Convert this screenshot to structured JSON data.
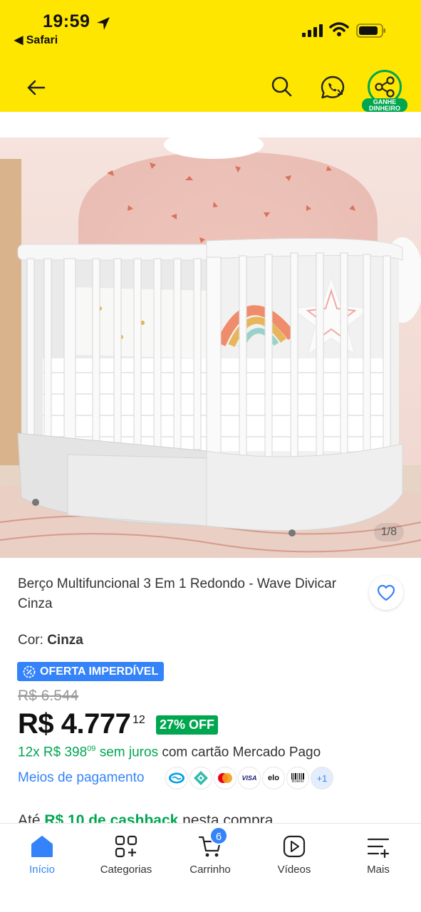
{
  "status_bar": {
    "time": "19:59",
    "back_app": "◀ Safari"
  },
  "header": {
    "share_badge_line1": "GANHE",
    "share_badge_line2": "DINHEIRO"
  },
  "gallery": {
    "counter": "1/8"
  },
  "product": {
    "title": "Berço Multifuncional 3 Em 1 Redondo - Wave Divicar Cinza",
    "color_label": "Cor: ",
    "color_value": "Cinza",
    "offer_badge": "OFERTA IMPERDÍVEL",
    "old_price": "R$ 6.544",
    "price": "R$ 4.777",
    "price_cents": "12",
    "discount": "27% OFF",
    "installments_prefix": "12x R$ 398",
    "installments_cents": "09",
    "installments_interest": " sem juros",
    "installments_suffix": " com cartão Mercado Pago",
    "payment_methods_link": "Meios de pagamento",
    "payment_icons": [
      "mercado-pago-icon",
      "pix-icon",
      "mastercard-icon",
      "visa-icon",
      "elo-icon",
      "boleto-icon"
    ],
    "payment_icon_labels": {
      "visa": "VISA",
      "elo": "elo",
      "boleto": "Boleto",
      "more": "+1"
    },
    "cashback_prefix": "Até ",
    "cashback_value": "R$ 10 de cashback",
    "cashback_suffix": " nesta compra"
  },
  "bottom_nav": {
    "items": [
      {
        "label": "Início"
      },
      {
        "label": "Categorias"
      },
      {
        "label": "Carrinho"
      },
      {
        "label": "Vídeos"
      },
      {
        "label": "Mais"
      }
    ],
    "cart_count": "6"
  },
  "colors": {
    "header_yellow": "#ffe600",
    "accent_blue": "#3483fa",
    "green": "#00a650"
  }
}
